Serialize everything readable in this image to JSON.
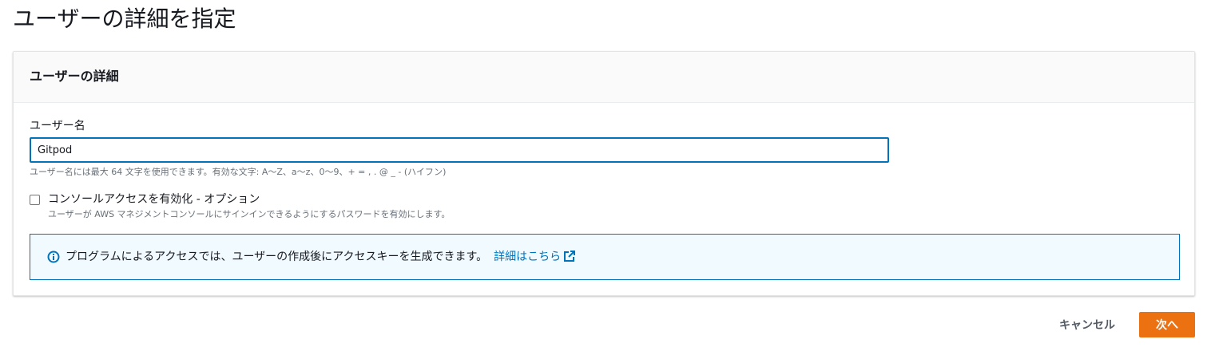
{
  "page": {
    "title": "ユーザーの詳細を指定"
  },
  "details_section": {
    "heading": "ユーザーの詳細",
    "username_label": "ユーザー名",
    "username_value": "Gitpod",
    "username_constraint": "ユーザー名には最大 64 文字を使用できます。有効な文字: A～Z、a～z、0～9、+ = , . @ _ - (ハイフン)",
    "console_access": {
      "checked": false,
      "label": "コンソールアクセスを有効化 - オプション",
      "description": "ユーザーが AWS マネジメントコンソールにサインインできるようにするパスワードを有効にします。"
    },
    "info_alert": {
      "icon": "info-icon",
      "text": "プログラムによるアクセスでは、ユーザーの作成後にアクセスキーを生成できます。",
      "link_text": "詳細はこちら",
      "link_icon": "external-link-icon"
    }
  },
  "actions": {
    "cancel_label": "キャンセル",
    "next_label": "次へ"
  },
  "colors": {
    "primary_button": "#ec7211",
    "focus_border": "#0073bb",
    "info_background": "#f1faff",
    "link": "#0073bb"
  }
}
